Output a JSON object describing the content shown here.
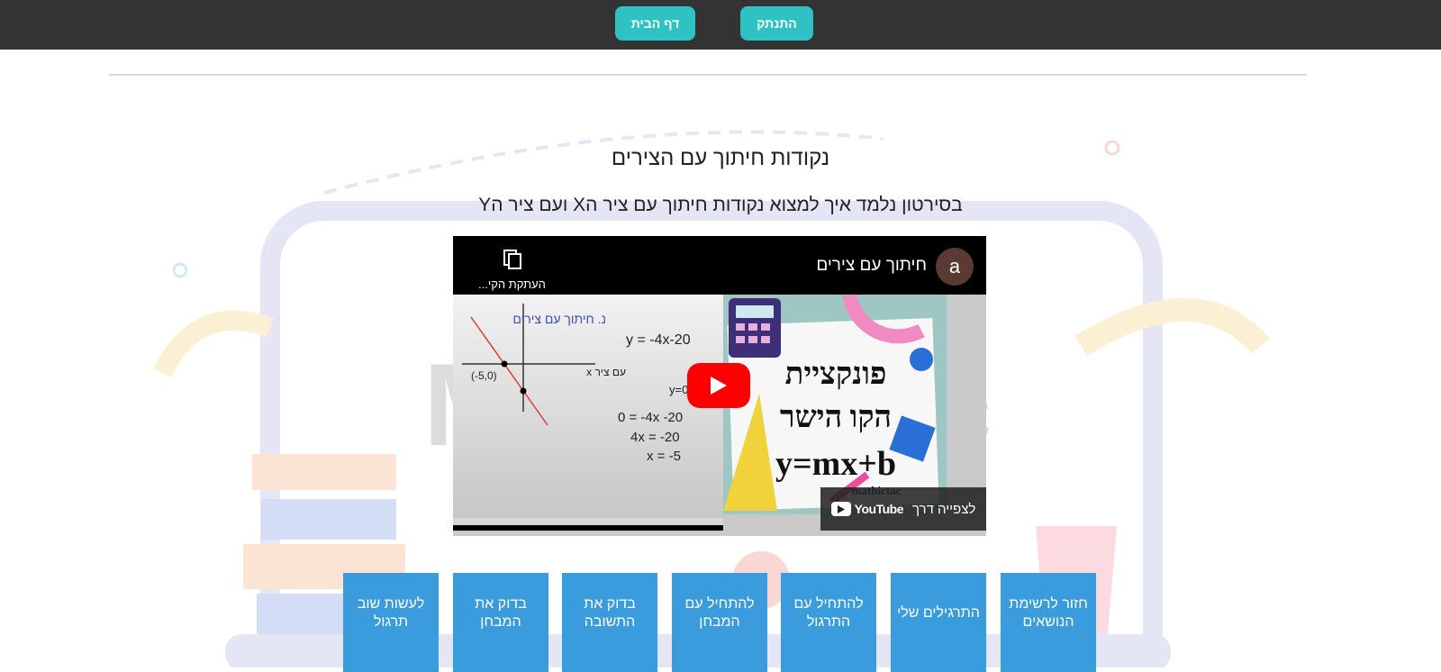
{
  "topbar": {
    "home_label": "דף הבית",
    "logout_label": "התנתק"
  },
  "page": {
    "title": "נקודות חיתוך עם הצירים",
    "description": "בסירטון נלמד איך למצוא נקודות חיתוך עם ציר הX ועם ציר הY"
  },
  "video": {
    "channel_initial": "a",
    "title": "חיתוך עם צירים",
    "copy_link_label": "העתקת הקי...",
    "thumbnail_line1": "פונקציית",
    "thumbnail_line2": "הקו הישר",
    "thumbnail_formula": "y=mx+b",
    "thumbnail_brand": "mathictac",
    "watch_on_label": "לצפייה דרך",
    "youtube_label": "YouTube",
    "whiteboard_heading": "נ. חיתוך עם צירים",
    "whiteboard_equation": "y = -4x-20",
    "whiteboard_step1": "0 = -4x -20",
    "whiteboard_step2": "4x = -20",
    "whiteboard_step3": "x = -5",
    "whiteboard_point": "(-5,0)",
    "whiteboard_note": "עם ציר x",
    "whiteboard_y0": "y=0"
  },
  "actions": [
    {
      "label": "חזור לרשימת הנושאים",
      "name": "back-to-topics-button"
    },
    {
      "label": "התרגילים שלי",
      "name": "my-exercises-button"
    },
    {
      "label": "להתחיל עם התרגול",
      "name": "start-practice-button"
    },
    {
      "label": "להתחיל עם המבחן",
      "name": "start-test-button"
    },
    {
      "label": "בדוק את התשובה",
      "name": "check-answer-button"
    },
    {
      "label": "בדוק את המבחן",
      "name": "check-test-button"
    },
    {
      "label": "לעשות שוב תרגול",
      "name": "redo-practice-button"
    }
  ],
  "colors": {
    "topbar": "#333333",
    "button_accent": "#2ec2c4",
    "action_tile": "#3a9cdc",
    "play_button": "#ff0000"
  }
}
